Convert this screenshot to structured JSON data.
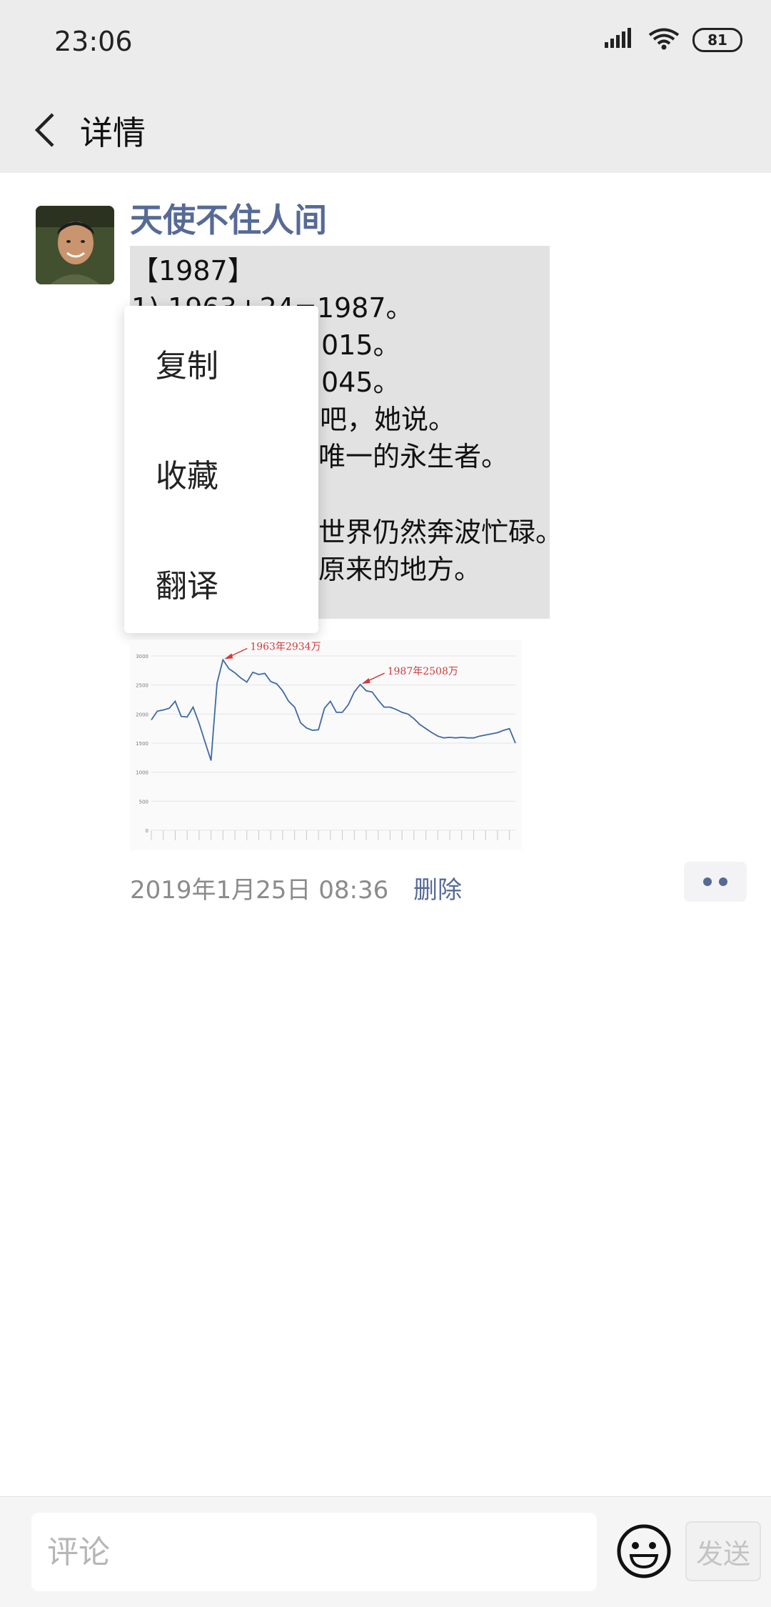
{
  "status_bar": {
    "time": "23:06",
    "battery": "81",
    "icons": [
      "signal-icon",
      "wifi-icon",
      "battery-icon"
    ]
  },
  "header": {
    "title": "详情",
    "back_icon": "back-arrow-icon"
  },
  "post": {
    "author": "天使不住人间",
    "text_lines": [
      "【1987】",
      "1) 1963+24=1987。",
      "015。",
      "045。",
      "吧，她说。",
      "唯一的永生者。",
      "世界仍然奔波忙碌。",
      "原来的地方。"
    ],
    "timestamp": "2019年1月25日 08:36",
    "delete_label": "删除"
  },
  "context_menu": {
    "items": [
      "复制",
      "收藏",
      "翻译"
    ]
  },
  "chart_data": {
    "type": "line",
    "series": [
      {
        "values": [
          1900,
          2050,
          2070,
          2100,
          2220,
          1960,
          1950,
          2120,
          1840,
          1520,
          1200,
          2530,
          2934,
          2780,
          2710,
          2620,
          2550,
          2720,
          2680,
          2700,
          2560,
          2520,
          2400,
          2220,
          2120,
          1850,
          1760,
          1720,
          1730,
          2100,
          2220,
          2030,
          2030,
          2160,
          2380,
          2508,
          2400,
          2380,
          2240,
          2120,
          2120,
          2080,
          2030,
          2000,
          1920,
          1820,
          1750,
          1680,
          1620,
          1590,
          1600,
          1590,
          1600,
          1590,
          1590,
          1620,
          1640,
          1660,
          1680,
          1720,
          1750,
          1500
        ]
      }
    ],
    "annotations": [
      {
        "label": "1963年2934万",
        "x_index": 12,
        "y": 2934
      },
      {
        "label": "1987年2508万",
        "x_index": 35,
        "y": 2508
      }
    ],
    "yticks": [
      "0",
      "500",
      "1000",
      "1500",
      "2000",
      "2500",
      "3000"
    ],
    "ylim": [
      0,
      3000
    ],
    "grid": true,
    "line_color": "#3d6aa6",
    "annotation_color": "#d23a3a"
  },
  "comment_bar": {
    "placeholder": "评论",
    "send_label": "发送",
    "emoji_icon": "emoji-icon"
  }
}
